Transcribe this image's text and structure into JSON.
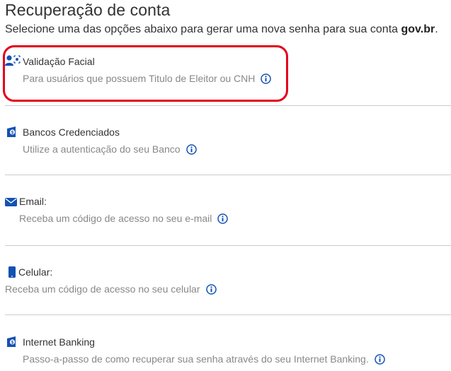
{
  "page": {
    "title": "Recuperação de conta",
    "subtitle_prefix": "Selecione uma das opções abaixo para gerar uma nova senha para sua conta ",
    "subtitle_brand": "gov.br",
    "subtitle_suffix": "."
  },
  "options": [
    {
      "title": "Validação Facial",
      "description": "Para usuários que possuem Titulo de Eleitor ou CNH",
      "icon": "face-id-icon"
    },
    {
      "title": "Bancos Credenciados",
      "description": "Utilize a autenticação do seu Banco",
      "icon": "bank-icon"
    },
    {
      "title": "Email:",
      "description": "Receba um código de acesso no seu e-mail",
      "icon": "envelope-icon"
    },
    {
      "title": "Celular:",
      "description": "Receba um código de acesso no seu celular",
      "icon": "mobile-phone-icon"
    },
    {
      "title": "Internet Banking",
      "description": "Passo-a-passo de como recuperar sua senha através do seu Internet Banking.",
      "icon": "bank-icon"
    }
  ],
  "colors": {
    "icon_blue": "#1351b4",
    "highlight_red": "#e3001b",
    "text": "#333333",
    "muted": "#888888",
    "divider": "#cccccc"
  }
}
